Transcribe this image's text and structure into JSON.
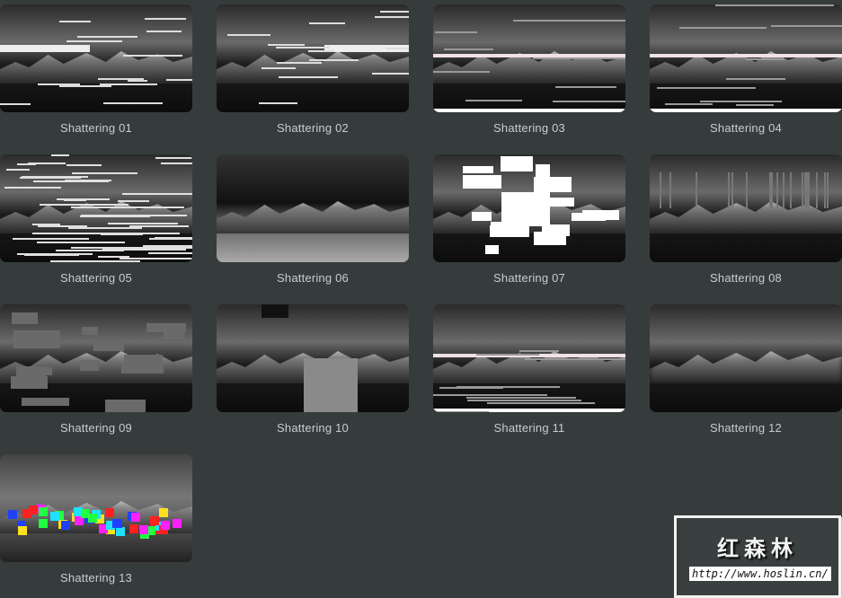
{
  "presets": [
    {
      "label": "Shattering 01",
      "style": "streak"
    },
    {
      "label": "Shattering 02",
      "style": "streak"
    },
    {
      "label": "Shattering 03",
      "style": "lines"
    },
    {
      "label": "Shattering 04",
      "style": "lines"
    },
    {
      "label": "Shattering 05",
      "style": "dense"
    },
    {
      "label": "Shattering 06",
      "style": "split"
    },
    {
      "label": "Shattering 07",
      "style": "blocks"
    },
    {
      "label": "Shattering 08",
      "style": "vertical"
    },
    {
      "label": "Shattering 09",
      "style": "greyblocks"
    },
    {
      "label": "Shattering 10",
      "style": "pixel"
    },
    {
      "label": "Shattering 11",
      "style": "lines"
    },
    {
      "label": "Shattering 12",
      "style": "blur"
    },
    {
      "label": "Shattering 13",
      "style": "rgb"
    }
  ],
  "watermark": {
    "title": "红森林",
    "url": "http://www.hoslin.cn/"
  }
}
